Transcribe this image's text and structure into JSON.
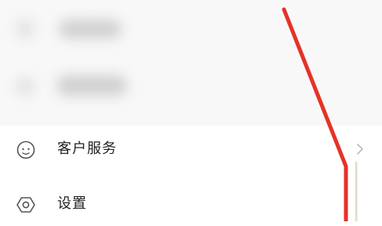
{
  "menu": {
    "items": [
      {
        "label": "客户服务",
        "icon": "customer-service-icon",
        "has_chevron": true
      },
      {
        "label": "设置",
        "icon": "settings-icon",
        "has_chevron": false
      }
    ]
  },
  "colors": {
    "annotation": "#e53228",
    "icon": "#555555",
    "chevron": "#bbbbbb"
  }
}
